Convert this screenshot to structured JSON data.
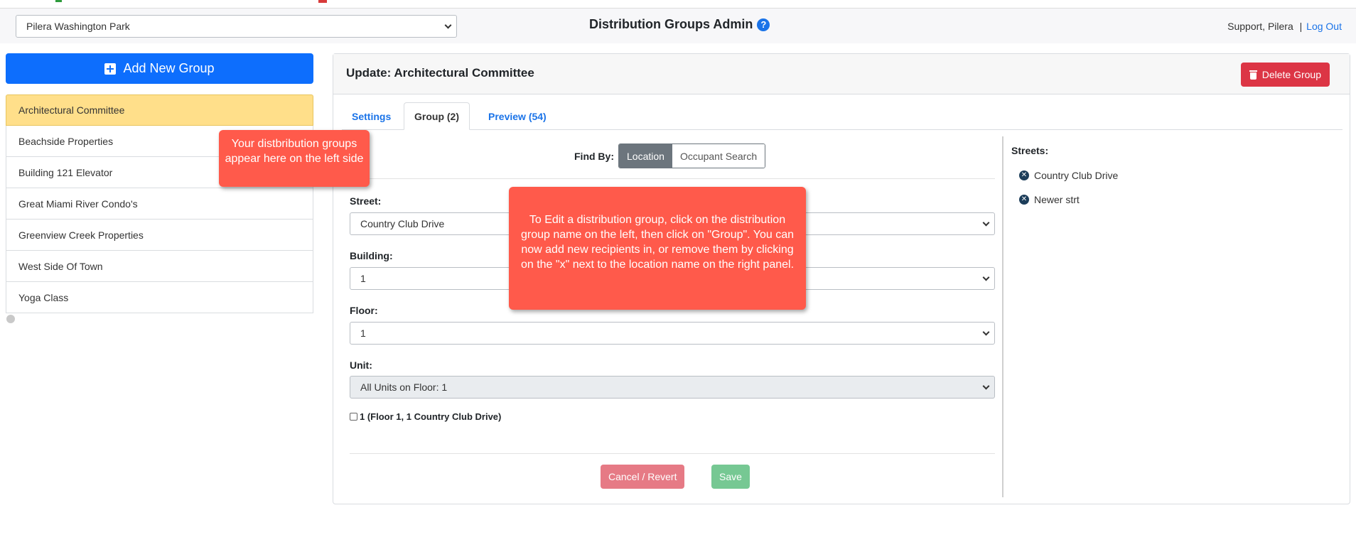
{
  "header": {
    "property_select": "Pilera Washington Park",
    "title": "Distribution Groups Admin",
    "help_icon": "?",
    "user": "Support, Pilera",
    "separator": "|",
    "logout": "Log Out"
  },
  "sidebar": {
    "add_button": "Add New Group",
    "groups": [
      {
        "label": "Architectural Committee",
        "active": true
      },
      {
        "label": "Beachside Properties"
      },
      {
        "label": "Building 121 Elevator"
      },
      {
        "label": "Great Miami River Condo's"
      },
      {
        "label": "Greenview Creek Properties"
      },
      {
        "label": "West Side Of Town"
      },
      {
        "label": "Yoga Class"
      }
    ]
  },
  "tooltips": {
    "sidebar_tip": "Your distbribution groups appear here on the left side",
    "edit_tip": "To Edit a distribution group, click on the distribution group name on the left, then click on \"Group\".  You can now add new recipients in, or remove them by clicking on the \"x\" next to the location name on the right panel."
  },
  "panel": {
    "title": "Update: Architectural Committee",
    "delete_button": "Delete Group",
    "tabs": [
      {
        "label": "Settings"
      },
      {
        "label": "Group (2)",
        "active": true
      },
      {
        "label": "Preview (54)"
      }
    ]
  },
  "form": {
    "find_by_label": "Find By:",
    "find_by_options": [
      "Location",
      "Occupant Search"
    ],
    "street_label": "Street:",
    "street_value": "Country Club Drive",
    "building_label": "Building:",
    "building_value": "1",
    "floor_label": "Floor:",
    "floor_value": "1",
    "unit_label": "Unit:",
    "unit_value": "All Units on Floor: 1",
    "checkbox_label": "1 (Floor 1, 1 Country Club Drive)",
    "cancel_button": "Cancel / Revert",
    "save_button": "Save"
  },
  "streets": {
    "title": "Streets:",
    "items": [
      "Country Club Drive",
      "Newer strt"
    ]
  },
  "colors": {
    "primary": "#0d6efd",
    "danger": "#dc3545",
    "active_group": "#ffdf8a",
    "tooltip": "#ff5a4b"
  }
}
